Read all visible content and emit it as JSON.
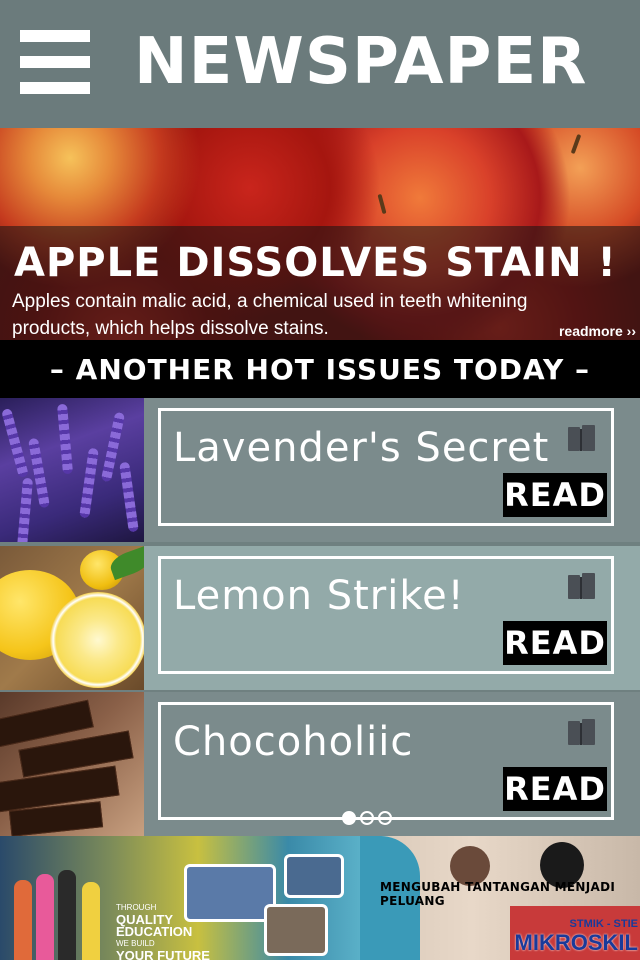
{
  "header": {
    "title": "NEWSPAPER",
    "menu_icon": "hamburger-menu-icon"
  },
  "hero": {
    "title": "APPLE DISSOLVES STAIN !",
    "description": "Apples contain malic acid, a chemical used in teeth whitening products, which helps dissolve stains.",
    "readmore": "readmore ››"
  },
  "section": {
    "title": "– ANOTHER HOT ISSUES TODAY –"
  },
  "articles": [
    {
      "title": "Lavender's Secret",
      "button": "READ",
      "icon": "book-icon",
      "image": "lavender"
    },
    {
      "title": "Lemon Strike!",
      "button": "READ",
      "icon": "book-icon",
      "image": "lemon"
    },
    {
      "title": "Chocoholiic",
      "button": "READ",
      "icon": "book-icon",
      "image": "chocolate"
    }
  ],
  "pager": {
    "total": 3,
    "active": 1
  },
  "ads": {
    "left": {
      "line1": "THROUGH",
      "line2": "QUALITY",
      "line3": "EDUCATION",
      "line4": "WE BUILD",
      "line5": "YOUR FUTURE"
    },
    "right": {
      "tagline": "MENGUBAH TANTANGAN  MENJADI PELUANG",
      "logo_small": "STMIK - STIE",
      "logo_big": "MIKROSKIL"
    }
  },
  "colors": {
    "header_bg": "#6b7b7c",
    "row_dark": "#7b8b8c",
    "row_light": "#93aaa9",
    "banner_bg": "#000000"
  }
}
